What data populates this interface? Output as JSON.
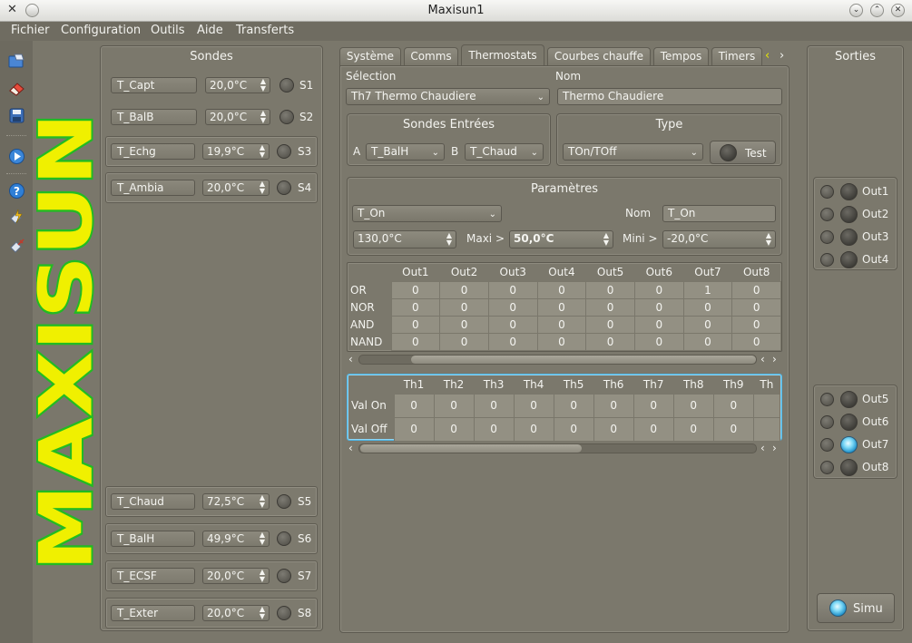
{
  "window": {
    "title": "Maxisun1"
  },
  "menu": [
    "Fichier",
    "Configuration",
    "Outils",
    "Aide",
    "Transferts"
  ],
  "logo_text": "MAXISUN",
  "sondes": {
    "title": "Sondes",
    "items": [
      {
        "label": "T_Capt",
        "value": "20,0°C",
        "id": "S1"
      },
      {
        "label": "T_BalB",
        "value": "20,0°C",
        "id": "S2"
      },
      {
        "label": "T_Echg",
        "value": "19,9°C",
        "id": "S3"
      },
      {
        "label": "T_Ambia",
        "value": "20,0°C",
        "id": "S4"
      },
      {
        "label": "T_Chaud",
        "value": "72,5°C",
        "id": "S5"
      },
      {
        "label": "T_BalH",
        "value": "49,9°C",
        "id": "S6"
      },
      {
        "label": "T_ECSF",
        "value": "20,0°C",
        "id": "S7"
      },
      {
        "label": "T_Exter",
        "value": "20,0°C",
        "id": "S8"
      }
    ]
  },
  "tabs": [
    "Système",
    "Comms",
    "Thermostats",
    "Courbes chauffe",
    "Tempos",
    "Timers"
  ],
  "active_tab": "Thermostats",
  "thermostat": {
    "selection_label": "Sélection",
    "selection_value": "Th7 Thermo Chaudiere",
    "nom_label": "Nom",
    "nom_value": "Thermo Chaudiere",
    "sondes_entrees": {
      "title": "Sondes Entrées",
      "a_label": "A",
      "a_value": "T_BalH",
      "b_label": "B",
      "b_value": "T_Chaud"
    },
    "type": {
      "title": "Type",
      "value": "TOn/TOff",
      "test_label": "Test"
    },
    "parametres": {
      "title": "Paramètres",
      "param_value": "T_On",
      "nom_label": "Nom",
      "nom_value": "T_On",
      "value": "130,0°C",
      "maxi_label": "Maxi >",
      "maxi_value": "50,0°C",
      "mini_label": "Mini >",
      "mini_value": "-20,0°C"
    },
    "logic_table": {
      "columns": [
        "Out1",
        "Out2",
        "Out3",
        "Out4",
        "Out5",
        "Out6",
        "Out7",
        "Out8"
      ],
      "rows": [
        {
          "label": "OR",
          "values": [
            "0",
            "0",
            "0",
            "0",
            "0",
            "0",
            "1",
            "0"
          ]
        },
        {
          "label": "NOR",
          "values": [
            "0",
            "0",
            "0",
            "0",
            "0",
            "0",
            "0",
            "0"
          ]
        },
        {
          "label": "AND",
          "values": [
            "0",
            "0",
            "0",
            "0",
            "0",
            "0",
            "0",
            "0"
          ]
        },
        {
          "label": "NAND",
          "values": [
            "0",
            "0",
            "0",
            "0",
            "0",
            "0",
            "0",
            "0"
          ]
        }
      ]
    },
    "val_table": {
      "columns": [
        "Th1",
        "Th2",
        "Th3",
        "Th4",
        "Th5",
        "Th6",
        "Th7",
        "Th8",
        "Th9",
        "Th"
      ],
      "rows": [
        {
          "label": "Val On",
          "values": [
            "0",
            "0",
            "0",
            "0",
            "0",
            "0",
            "0",
            "0",
            "0",
            ""
          ]
        },
        {
          "label": "Val Off",
          "values": [
            "0",
            "0",
            "0",
            "0",
            "0",
            "0",
            "0",
            "0",
            "0",
            ""
          ]
        }
      ]
    }
  },
  "sorties": {
    "title": "Sorties",
    "outputs": [
      {
        "label": "Out1",
        "on": false
      },
      {
        "label": "Out2",
        "on": false
      },
      {
        "label": "Out3",
        "on": false
      },
      {
        "label": "Out4",
        "on": false
      },
      {
        "label": "Out5",
        "on": false
      },
      {
        "label": "Out6",
        "on": false
      },
      {
        "label": "Out7",
        "on": true
      },
      {
        "label": "Out8",
        "on": false
      }
    ],
    "simu_label": "Simu"
  }
}
